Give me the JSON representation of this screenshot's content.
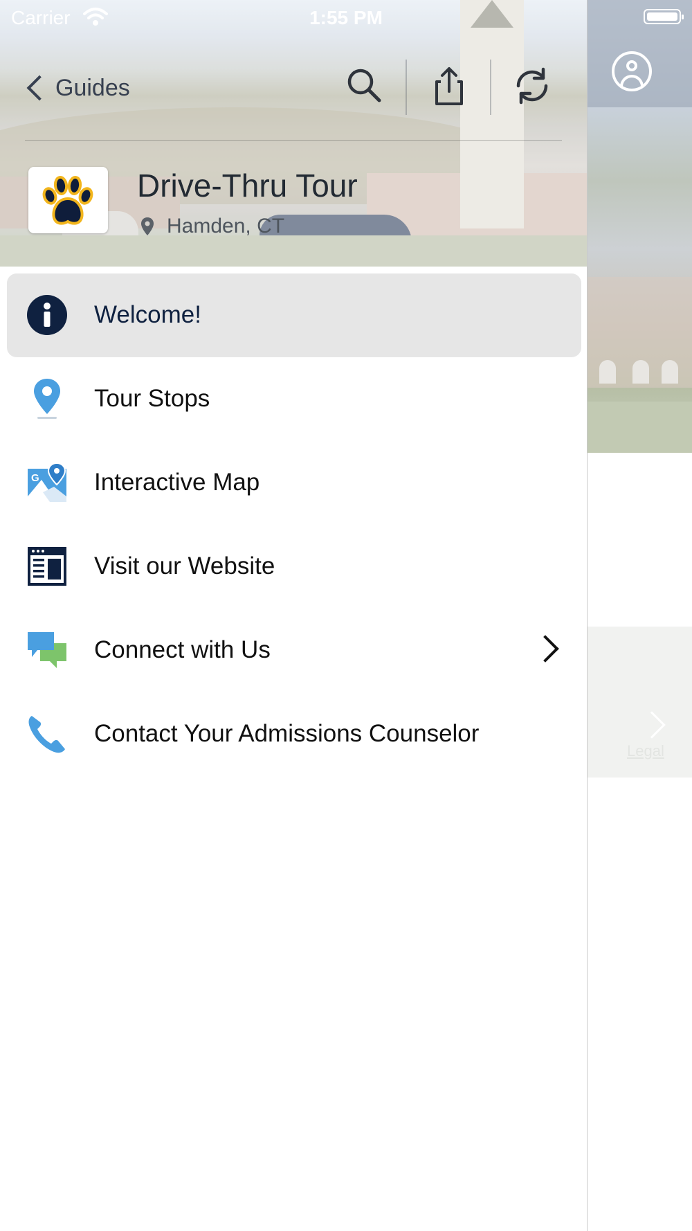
{
  "status_bar": {
    "carrier": "Carrier",
    "time": "1:55 PM"
  },
  "nav": {
    "back_label": "Guides",
    "icons": [
      "search-icon",
      "share-icon",
      "refresh-icon"
    ]
  },
  "guide": {
    "title": "Drive-Thru Tour",
    "location": "Hamden, CT",
    "logo_icon": "paw-icon"
  },
  "menu": {
    "items": [
      {
        "label": "Welcome!",
        "icon": "info-icon",
        "active": true
      },
      {
        "label": "Tour Stops",
        "icon": "location-pin-icon"
      },
      {
        "label": "Interactive Map",
        "icon": "map-icon"
      },
      {
        "label": "Visit our Website",
        "icon": "website-icon"
      },
      {
        "label": "Connect with Us",
        "icon": "chat-icon",
        "has_submenu": true
      },
      {
        "label": "Contact Your Admissions Counselor",
        "icon": "phone-icon"
      }
    ]
  },
  "background": {
    "legal_link": "Legal",
    "profile_icon": "user-circle-icon"
  },
  "colors": {
    "navy": "#0f2140",
    "gold": "#f2b51c",
    "accent_blue": "#4a9fe0",
    "chat_green": "#7dc46b",
    "active_row": "#e6e6e6"
  }
}
